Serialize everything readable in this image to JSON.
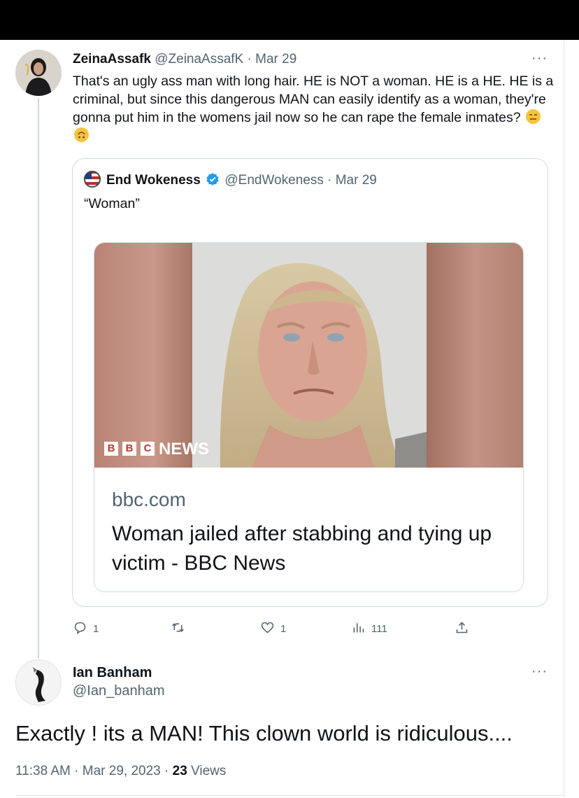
{
  "reply_tweet": {
    "author_name": "ZeinaAssafk",
    "author_handle": "@ZeinaAssafK",
    "sep": "·",
    "date": "Mar 29",
    "more": "···",
    "text": "That's an ugly ass man with long hair. HE is NOT a woman. HE is a HE. HE is a criminal, but since this dangerous MAN can easily identify as a woman, they're gonna put him in the womens jail now so he can rape the female inmates?",
    "emojis": [
      "expressionless-face",
      "upside-down-face"
    ]
  },
  "quoted_tweet": {
    "author_name": "End Wokeness",
    "author_handle": "@EndWokeness",
    "sep": "·",
    "date": "Mar 29",
    "text": "“Woman”",
    "card": {
      "image_alt": "Custody photo of a person with long blond hair",
      "brand_letters": [
        "B",
        "B",
        "C"
      ],
      "brand_word": "NEWS",
      "domain": "bbc.com",
      "title": "Woman jailed after stabbing and tying up victim - BBC News"
    }
  },
  "actions": {
    "reply_count": "1",
    "retweet_count": "",
    "like_count": "1",
    "views_count": "111",
    "icons": [
      "reply-icon",
      "retweet-icon",
      "like-icon",
      "views-icon",
      "share-icon"
    ]
  },
  "main_tweet": {
    "author_name": "Ian Banham",
    "author_handle": "@Ian_banham",
    "more": "···",
    "text": "Exactly ! its a MAN! This clown world is ridiculous....",
    "time": "11:38 AM",
    "sep1": "·",
    "date": "Mar 29, 2023",
    "sep2": "·",
    "views_count": "23",
    "views_label": "Views"
  },
  "colors": {
    "accent": "#1d9bf0",
    "muted": "#536471",
    "border": "#cfd9de",
    "bbc_red": "#bb1919"
  }
}
